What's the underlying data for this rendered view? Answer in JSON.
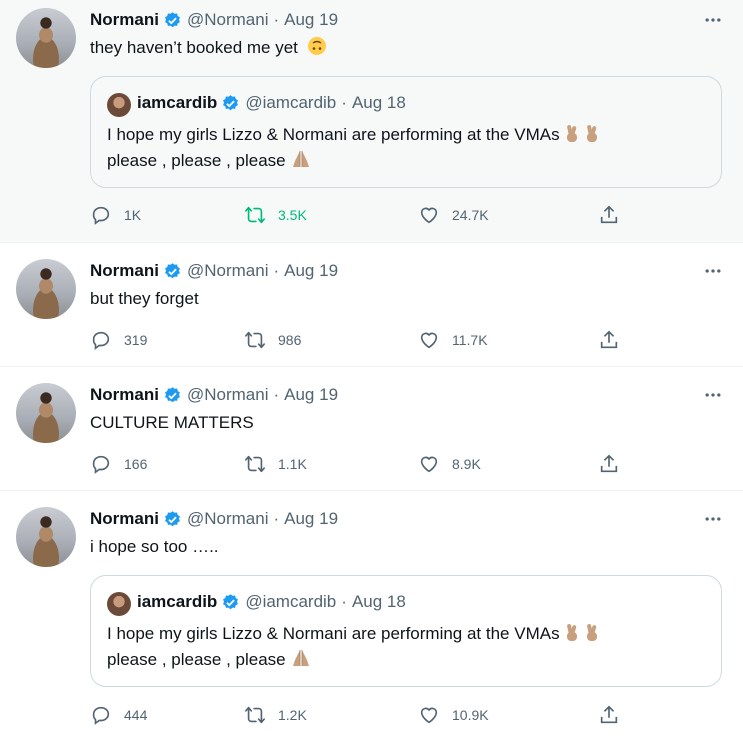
{
  "tweets": [
    {
      "name": "Normani",
      "handle": "@Normani",
      "date": "Aug 19",
      "text": "they haven’t booked me yet",
      "text_emoji": "upside-down-face",
      "quote": {
        "name": "iamcardib",
        "handle": "@iamcardib",
        "date": "Aug 18",
        "line1": "I hope my girls Lizzo & Normani are performing at the VMAs",
        "line1_emoji": "crossed-fingers",
        "line2": "please , please , please",
        "line2_emoji": "folded-hands"
      },
      "replies": "1K",
      "retweets": "3.5K",
      "likes": "24.7K",
      "retweeted": true
    },
    {
      "name": "Normani",
      "handle": "@Normani",
      "date": "Aug 19",
      "text": "but they forget",
      "replies": "319",
      "retweets": "986",
      "likes": "11.7K"
    },
    {
      "name": "Normani",
      "handle": "@Normani",
      "date": "Aug 19",
      "text": "CULTURE MATTERS",
      "replies": "166",
      "retweets": "1.1K",
      "likes": "8.9K"
    },
    {
      "name": "Normani",
      "handle": "@Normani",
      "date": "Aug 19",
      "text": "i hope so too …..",
      "quote": {
        "name": "iamcardib",
        "handle": "@iamcardib",
        "date": "Aug 18",
        "line1": "I hope my girls Lizzo & Normani are performing at the VMAs",
        "line1_emoji": "crossed-fingers",
        "line2": "please , please , please",
        "line2_emoji": "folded-hands"
      },
      "replies": "444",
      "retweets": "1.2K",
      "likes": "10.9K"
    }
  ],
  "colors": {
    "verified": "#1d9bf0",
    "retweet_active": "#00ba7c",
    "muted": "#536471",
    "highlight_bg": "#f7f9f9"
  }
}
